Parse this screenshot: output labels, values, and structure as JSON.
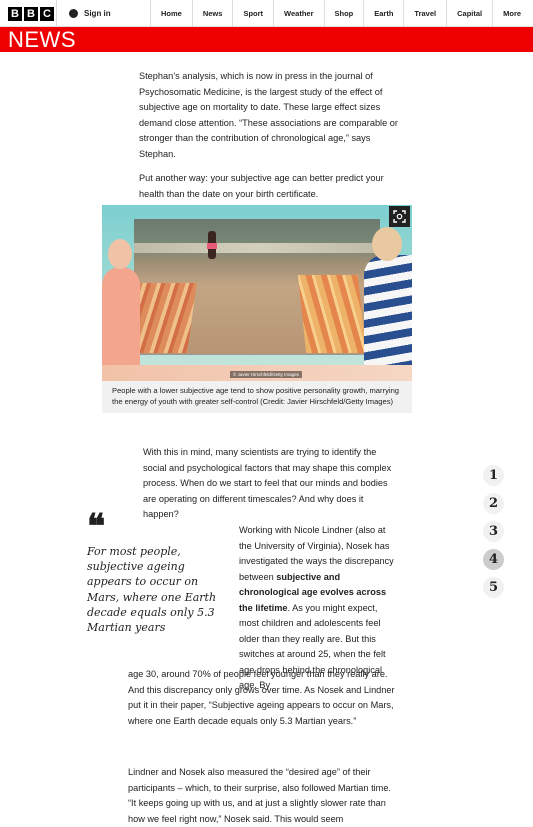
{
  "header": {
    "logo_letters": [
      "B",
      "B",
      "C"
    ],
    "sign_in": "Sign in",
    "nav": [
      "Home",
      "News",
      "Sport",
      "Weather",
      "Shop",
      "Earth",
      "Travel",
      "Capital",
      "More"
    ]
  },
  "section": {
    "title": "NEWS",
    "color": "#ee0000"
  },
  "article": {
    "para1": "Stephan’s analysis, which is now in press in the journal of Psychosomatic Medicine, is the largest study of the effect of subjective age on mortality to date. These large effect sizes demand close attention. “These associations are comparable or stronger than the contribution of chronological age,” says Stephan.",
    "para2": "Put another way: your subjective age can better predict your health than the date on your birth certificate.",
    "image_credit_tag": "© Javier Hirschfeld/Getty Images",
    "caption": "People with a lower subjective age tend to show positive personality growth, marrying the energy of youth with greater self-control (Credit: Javier Hirschfeld/Getty Images)",
    "para3": "With this in mind, many scientists are trying to identify the social and psychological factors that may shape this complex process. When do we start to feel that our minds and bodies are operating on different timescales? And why does it happen?",
    "quote_mark": "❝",
    "pull_quote": "For most people, subjective ageing appears to occur on Mars, where one Earth decade equals only 5.3 Martian years",
    "para4_a": "Working with Nicole Lindner (also at the University of Virginia), Nosek has investigated the ways the discrepancy between ",
    "para4_bold": "subjective and chronological age evolves across the lifetime",
    "para4_b": ". As you might expect, most children and adolescents feel older than they really are. But this switches at around 25, when the felt age drops behind the chronological age. By",
    "para5": "age 30, around 70% of people feel younger than they really are. And this discrepancy only grows over time. As Nosek and Lindner put it in their paper, “Subjective ageing appears to occur on Mars, where one Earth decade equals only 5.3 Martian years.”",
    "para6": "Lindner and Nosek also measured the “desired age” of their participants – which, to their surprise, also followed Martian time. “It keeps going up with us, and at just a slightly slower rate than how we feel right now,” Nosek said. This would seem"
  },
  "steps": [
    "1",
    "2",
    "3",
    "4",
    "5"
  ],
  "active_step": "4"
}
